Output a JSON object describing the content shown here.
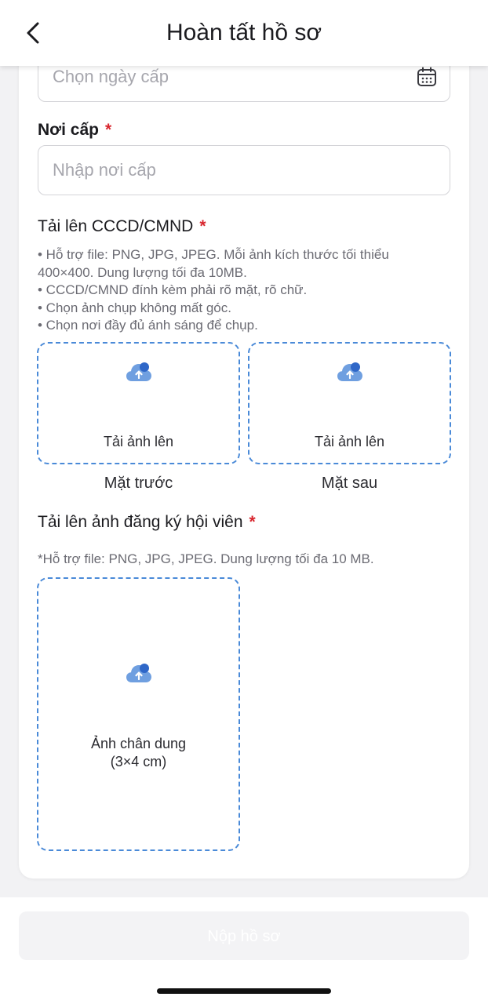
{
  "header": {
    "title": "Hoàn tất hồ sơ"
  },
  "issue_date": {
    "placeholder": "Chọn ngày cấp",
    "icon": "calendar-icon"
  },
  "issue_place": {
    "label": "Nơi cấp",
    "required_mark": "*",
    "placeholder": "Nhập nơi cấp"
  },
  "id_upload": {
    "label": "Tải lên CCCD/CMND",
    "required_mark": "*",
    "notes": [
      "• Hỗ trợ file: PNG, JPG, JPEG. Mỗi ảnh kích thước tối thiểu",
      "400×400. Dung lượng tối đa 10MB.",
      "• CCCD/CMND đính kèm phải rõ mặt, rõ chữ.",
      "• Chọn ảnh chụp không mất góc.",
      "• Chọn nơi đầy đủ ánh sáng để chụp."
    ],
    "front": {
      "button_label": "Tải ảnh lên",
      "caption": "Mặt trước"
    },
    "back": {
      "button_label": "Tải ảnh lên",
      "caption": "Mặt sau"
    }
  },
  "member_photo": {
    "label": "Tải lên ảnh đăng ký hội viên",
    "required_mark": "*",
    "hint": "*Hỗ trợ file: PNG, JPG, JPEG. Dung lượng tối đa 10 MB.",
    "upload_label_line1": "Ảnh chân dung",
    "upload_label_line2": "(3×4 cm)"
  },
  "submit": {
    "label": "Nộp hồ sơ"
  },
  "colors": {
    "accent_blue": "#4a8ad8",
    "required_red": "#d8262e",
    "disabled_button": "#f3f3f5"
  }
}
